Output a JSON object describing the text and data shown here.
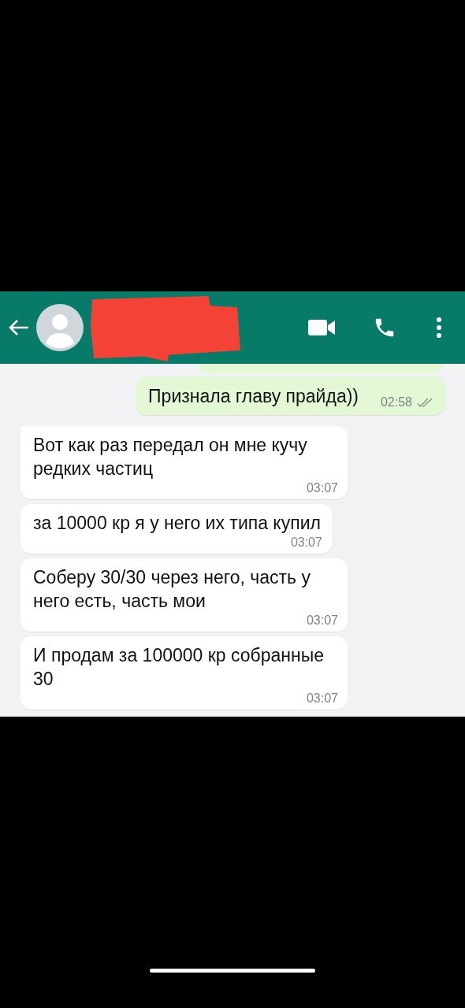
{
  "messages": [
    {
      "kind": "out",
      "text": "Признала главу прайда))",
      "time": "02:58",
      "read": false
    },
    {
      "kind": "in",
      "text": "Вот как раз передал он мне кучу редких частиц",
      "time": "03:07",
      "first": true
    },
    {
      "kind": "in",
      "text": "за 10000 кр я у него их типа купил",
      "time": "03:07",
      "first": false
    },
    {
      "kind": "in",
      "text": "Соберу 30/30 через него, часть у него есть, часть мои",
      "time": "03:07",
      "first": false
    },
    {
      "kind": "in",
      "text": "И продам за 100000 кр собранные 30",
      "time": "03:07",
      "first": false
    }
  ]
}
